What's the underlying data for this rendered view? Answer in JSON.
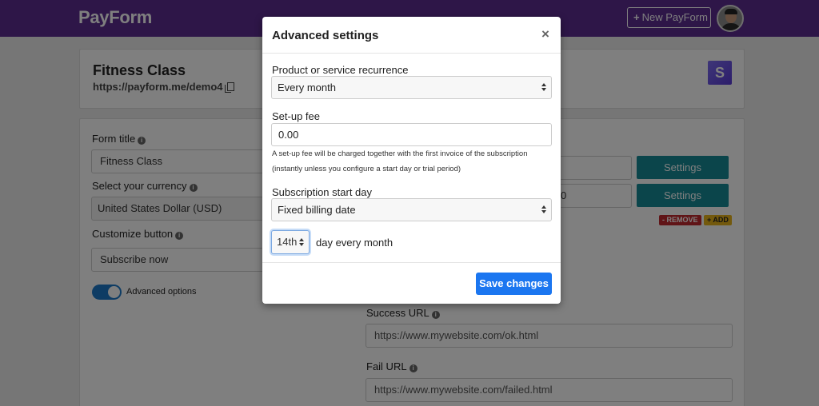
{
  "header": {
    "logo": "PayForm",
    "new_button_icon": "+",
    "new_button_label": "New PayForm"
  },
  "title_card": {
    "title": "Fitness Class",
    "url": "https://payform.me/demo4",
    "stripe_letter": "S"
  },
  "form": {
    "form_title_label": "Form title",
    "form_title_value": "Fitness Class",
    "currency_label": "Select your currency",
    "currency_value": "United States Dollar (USD)",
    "button_label": "Customize button",
    "button_value": "Subscribe now",
    "advanced_label": "Advanced options",
    "settings_label": "Settings",
    "price_value_partial": "0",
    "remove_label": "- REMOVE",
    "add_label": "+ ADD",
    "success_label": "Success URL",
    "success_value": "https://www.mywebsite.com/ok.html",
    "fail_label": "Fail URL",
    "fail_value": "https://www.mywebsite.com/failed.html"
  },
  "modal": {
    "title": "Advanced settings",
    "close": "×",
    "recurrence_label": "Product or service recurrence",
    "recurrence_value": "Every month",
    "setup_fee_label": "Set-up fee",
    "setup_fee_value": "0.00",
    "setup_fee_help_1": "A set-up fee will be charged together with the first invoice of the subscription",
    "setup_fee_help_2": "(instantly unless you configure a start day or trial period)",
    "start_day_label": "Subscription start day",
    "start_day_value": "Fixed billing date",
    "billing_day_value": "14th",
    "billing_day_suffix": "day every month",
    "save_label": "Save changes"
  },
  "colors": {
    "header": "#5c2d91",
    "settings_button": "#168a96",
    "save_button": "#1b76f0",
    "remove_badge": "#c0282e",
    "add_badge": "#e7b21a"
  }
}
